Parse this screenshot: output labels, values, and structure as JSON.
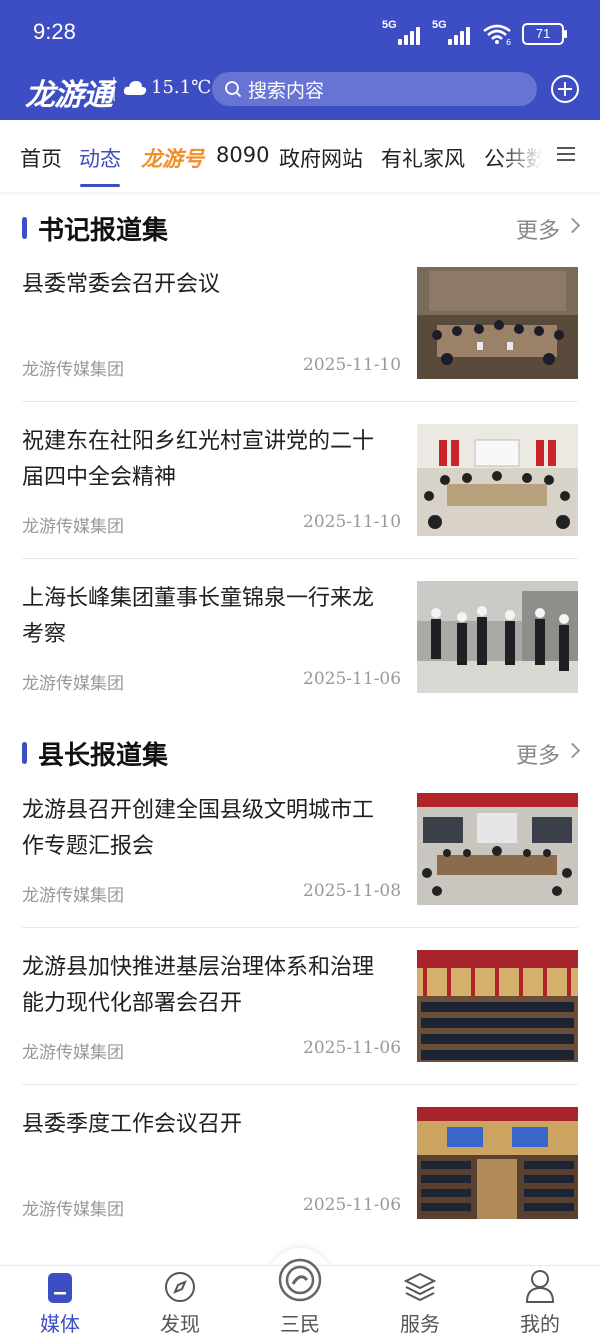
{
  "status_bar": {
    "time": "9:28",
    "signal_1": "5G",
    "signal_2": "5G",
    "wifi_level": "6",
    "battery": "71"
  },
  "header": {
    "logo": "龙游通",
    "temperature": "15.1℃",
    "search_placeholder": "搜索内容"
  },
  "tabs": [
    {
      "label": "首页"
    },
    {
      "label": "动态"
    },
    {
      "label": "龙游号"
    },
    {
      "label": "8090"
    },
    {
      "label": "政府网站"
    },
    {
      "label": "有礼家风"
    },
    {
      "label": "公共数"
    }
  ],
  "sections": [
    {
      "title": "书记报道集",
      "more": "更多",
      "articles": [
        {
          "title": "县委常委会召开会议",
          "source": "龙游传媒集团",
          "date": "2025-11-10"
        },
        {
          "title": "祝建东在社阳乡红光村宣讲党的二十届四中全会精神",
          "source": "龙游传媒集团",
          "date": "2025-11-10"
        },
        {
          "title": "上海长峰集团董事长童锦泉一行来龙考察",
          "source": "龙游传媒集团",
          "date": "2025-11-06"
        }
      ]
    },
    {
      "title": "县长报道集",
      "more": "更多",
      "articles": [
        {
          "title": "龙游县召开创建全国县级文明城市工作专题汇报会",
          "source": "龙游传媒集团",
          "date": "2025-11-08"
        },
        {
          "title": "龙游县加快推进基层治理体系和治理能力现代化部署会召开",
          "source": "龙游传媒集团",
          "date": "2025-11-06"
        },
        {
          "title": "县委季度工作会议召开",
          "source": "龙游传媒集团",
          "date": "2025-11-06"
        }
      ]
    }
  ],
  "bottom_nav": [
    {
      "label": "媒体",
      "icon": "media-icon"
    },
    {
      "label": "发现",
      "icon": "compass-icon"
    },
    {
      "label": "三民",
      "icon": "sanmin-icon"
    },
    {
      "label": "服务",
      "icon": "layers-icon"
    },
    {
      "label": "我的",
      "icon": "person-icon"
    }
  ],
  "colors": {
    "brand": "#3d4dc4",
    "accent_orange": "#f0902a"
  }
}
